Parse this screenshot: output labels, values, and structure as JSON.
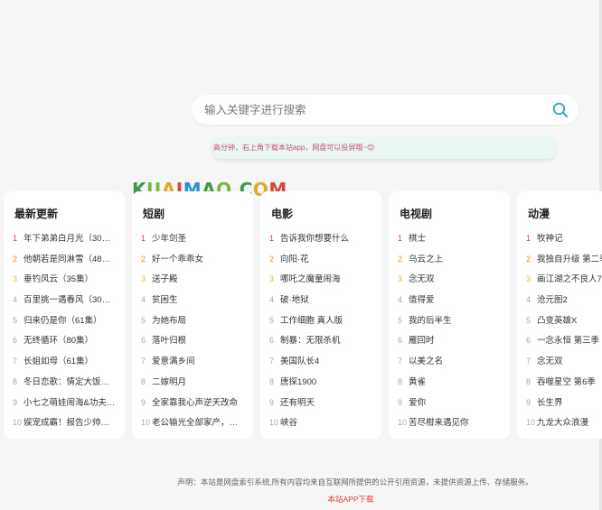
{
  "search": {
    "placeholder": "输入关键字进行搜索"
  },
  "notice": {
    "text": "高分钟，右上角下载本站app，网盘可以投屏哦~😊"
  },
  "logo": {
    "text": "KUAIMAO.COM",
    "colors": [
      "#3a9a48",
      "#7ab83f",
      "#e0a92a",
      "#d64a3a",
      "#2f8fd0",
      "#3a9a48",
      "#7ab83f",
      "#2d2d2d",
      "#3a9a48",
      "#e0a92a",
      "#d64a3a"
    ]
  },
  "colors": {
    "rank1": "#e4393c",
    "rank2": "#ef8b25",
    "rank3": "#f2b33d",
    "accent": "#3aa7b4"
  },
  "cards": [
    {
      "title": "最新更新",
      "items": [
        "年下弟弟白月光（30…",
        "他朝若是同淋雪（48…",
        "垂钓风云（35集）",
        "百里挑一遇春风（30…",
        "归来仍是你（61集）",
        "无终循环（80集）",
        "长姐如母（61集）",
        "冬日恋歌：情定大饭…",
        "小七之萌娃闹海&功夫…",
        "娱宠成霸！报告少帅…"
      ]
    },
    {
      "title": "短剧",
      "items": [
        "少年剑圣",
        "好一个乖乖女",
        "送子殿",
        "贫困生",
        "为她布局",
        "落叶归根",
        "爱意满乡间",
        "二嫁明月",
        "全家靠我心声逆天改命",
        "老公输光全部家产，…"
      ]
    },
    {
      "title": "电影",
      "items": [
        "告诉我你想要什么",
        "向阳·花",
        "哪吒之魔童闹海",
        "破·地狱",
        "工作细胞 真人版",
        "制暴：无限杀机",
        "美国队长4",
        "唐探1900",
        "还有明天",
        "峡谷"
      ]
    },
    {
      "title": "电视剧",
      "items": [
        "棋士",
        "乌云之上",
        "念无双",
        "值得爱",
        "我的后半生",
        "雁回时",
        "以美之名",
        "黄雀",
        "爱你",
        "苦尽柑来遇见你"
      ]
    },
    {
      "title": "动漫",
      "items": [
        "牧神记",
        "我独自升级 第二季",
        "画江湖之不良人7",
        "沧元图2",
        "凸变英雄X",
        "一念永恒 第三季",
        "念无双",
        "吞噬星空 第6季",
        "长生界",
        "九龙大众浪漫"
      ]
    }
  ],
  "footer": {
    "statement": "声明：本站是网盘索引系统,所有内容均来自互联网所提供的公开引用资源，未提供资源上传、存储服务。",
    "app_link": "本站APP下载"
  }
}
